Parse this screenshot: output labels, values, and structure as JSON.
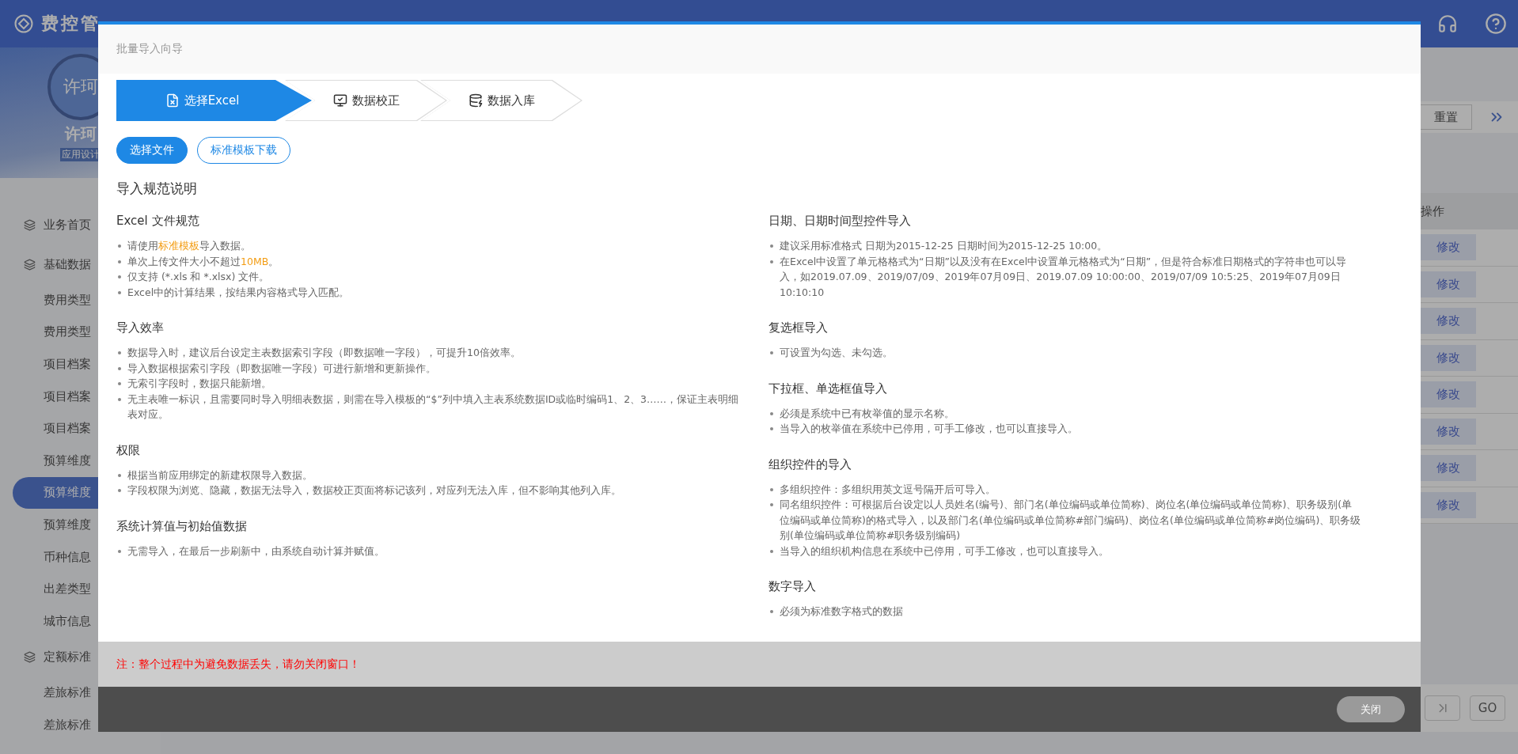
{
  "header": {
    "logo": "费控管"
  },
  "profile": {
    "avatar": "许珂",
    "name": "许珂",
    "role": "应用设计"
  },
  "sidebar": {
    "items": [
      {
        "kind": "group",
        "label": "业务首页",
        "selected": false
      },
      {
        "kind": "group",
        "label": "基础数据",
        "selected": false
      },
      {
        "kind": "item",
        "label": "费用类型",
        "selected": false
      },
      {
        "kind": "item",
        "label": "费用类型",
        "selected": false
      },
      {
        "kind": "item",
        "label": "项目档案",
        "selected": false
      },
      {
        "kind": "item",
        "label": "项目档案",
        "selected": false
      },
      {
        "kind": "item",
        "label": "项目档案",
        "selected": false
      },
      {
        "kind": "item",
        "label": "预算维度",
        "selected": false
      },
      {
        "kind": "item",
        "label": "预算维度",
        "selected": true
      },
      {
        "kind": "item",
        "label": "预算维度",
        "selected": false
      },
      {
        "kind": "item",
        "label": "币种信息",
        "selected": false
      },
      {
        "kind": "item",
        "label": "出差类型",
        "selected": false
      },
      {
        "kind": "item",
        "label": "城市信息",
        "selected": false
      },
      {
        "kind": "group",
        "label": "定额标准",
        "selected": false
      },
      {
        "kind": "item",
        "label": "差旅标准",
        "selected": false
      },
      {
        "kind": "item",
        "label": "差旅标准",
        "selected": false
      }
    ]
  },
  "toolbar": {
    "reset_button": "重置"
  },
  "table": {
    "column": "操作",
    "rows": [
      {
        "action": "修改"
      },
      {
        "action": "修改"
      },
      {
        "action": "修改"
      },
      {
        "action": "修改"
      },
      {
        "action": "修改"
      },
      {
        "action": "修改"
      },
      {
        "action": "修改"
      },
      {
        "action": "修改"
      }
    ]
  },
  "pagination": {
    "go_button": "GO"
  },
  "modal": {
    "title": "批量导入向导",
    "steps": [
      {
        "kind": "excel",
        "label": "选择Excel",
        "selected": true
      },
      {
        "kind": "check",
        "label": "数据校正",
        "selected": false
      },
      {
        "kind": "database",
        "label": "数据入库",
        "selected": false
      }
    ],
    "buttons": [
      {
        "kind": "primary",
        "label": "选择文件"
      },
      {
        "kind": "outline",
        "label": "标准模板下载"
      }
    ],
    "heading": "导入规范说明",
    "columns": [
      [
        {
          "title": "Excel 文件规范",
          "items": [
            "请使用**标准模板**导入数据。",
            "单次上传文件大小不超过**10MB**。",
            "仅支持 (*.xls 和 *.xlsx) 文件。",
            "Excel中的计算结果，按结果内容格式导入匹配。"
          ]
        },
        {
          "title": "导入效率",
          "items": [
            "数据导入时，建议后台设定主表数据索引字段（即数据唯一字段），可提升10倍效率。",
            "导入数据根据索引字段（即数据唯一字段）可进行新增和更新操作。",
            "无索引字段时，数据只能新增。",
            "无主表唯一标识，且需要同时导入明细表数据，则需在导入模板的“$”列中填入主表系统数据ID或临时编码1、2、3……，保证主表明细表对应。"
          ]
        },
        {
          "title": "权限",
          "items": [
            "根据当前应用绑定的新建权限导入数据。",
            "字段权限为浏览、隐藏，数据无法导入，数据校正页面将标记该列，对应列无法入库，但不影响其他列入库。"
          ]
        },
        {
          "title": "系统计算值与初始值数据",
          "items": [
            "无需导入，在最后一步刷新中，由系统自动计算并赋值。"
          ]
        }
      ],
      [
        {
          "title": "日期、日期时间型控件导入",
          "items": [
            "建议采用标准格式 日期为2015-12-25 日期时间为2015-12-25 10:00。",
            "在Excel中设置了单元格格式为“日期”以及没有在Excel中设置单元格格式为“日期”，但是符合标准日期格式的字符串也可以导入，如2019.07.09、2019/07/09、2019年07月09日、2019.07.09 10:00:00、2019/07/09 10:5:25、2019年07月09日 10:10:10"
          ]
        },
        {
          "title": "复选框导入",
          "items": [
            "可设置为勾选、未勾选。"
          ]
        },
        {
          "title": "下拉框、单选框值导入",
          "items": [
            "必须是系统中已有枚举值的显示名称。",
            "当导入的枚举值在系统中已停用，可手工修改，也可以直接导入。"
          ]
        },
        {
          "title": "组织控件的导入",
          "items": [
            "多组织控件：多组织用英文逗号隔开后可导入。",
            "同名组织控件：可根据后台设定以人员姓名(编号)、部门名(单位编码或单位简称)、岗位名(单位编码或单位简称)、职务级别(单位编码或单位简称)的格式导入，以及部门名(单位编码或单位简称#部门编码)、岗位名(单位编码或单位简称#岗位编码)、职务级别(单位编码或单位简称#职务级别编码)",
            "当导入的组织机构信息在系统中已停用，可手工修改，也可以直接导入。"
          ]
        },
        {
          "title": "数字导入",
          "items": [
            "必须为标准数字格式的数据"
          ]
        }
      ]
    ],
    "note": "注：整个过程中为避免数据丢失，请勿关闭窗口！",
    "close_button": "关闭"
  }
}
